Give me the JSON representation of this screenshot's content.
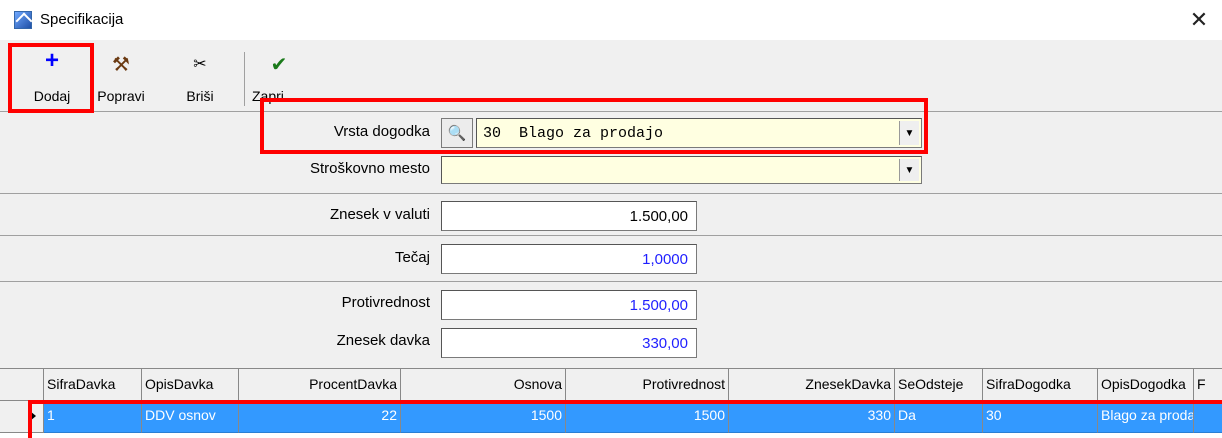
{
  "window": {
    "title": "Specifikacija",
    "close_glyph": "✕"
  },
  "toolbar": {
    "buttons": [
      {
        "label": "Dodaj",
        "icon": "plus-icon",
        "icon_glyph": "+",
        "color": "#0000ff"
      },
      {
        "label": "Popravi",
        "icon": "hammer-icon",
        "icon_glyph": "⚒",
        "color": "#6b3a12"
      },
      {
        "label": "Briši",
        "icon": "scissors-icon",
        "icon_glyph": "✂",
        "color": "#000000"
      },
      {
        "label": "Zapri",
        "icon": "checkmark-icon",
        "icon_glyph": "✔",
        "color": "#1a7a1a"
      }
    ]
  },
  "form": {
    "vrsta_dogodka": {
      "label": "Vrsta dogodka",
      "value": "30  Blago za prodajo"
    },
    "stroskovno_mesto": {
      "label": "Stroškovno mesto",
      "value": ""
    },
    "znesek_v_valuti": {
      "label": "Znesek v valuti",
      "value": "1.500,00"
    },
    "tecaj": {
      "label": "Tečaj",
      "value": "1,0000"
    },
    "protivrednost": {
      "label": "Protivrednost",
      "value": "1.500,00"
    },
    "znesek_davka": {
      "label": "Znesek davka",
      "value": "330,00"
    }
  },
  "grid": {
    "columns": [
      "SifraDavka",
      "OpisDavka",
      "ProcentDavka",
      "Osnova",
      "Protivrednost",
      "ZnesekDavka",
      "SeOdsteje",
      "SifraDogodka",
      "OpisDogodka",
      "F"
    ],
    "rows": [
      {
        "SifraDavka": "1",
        "OpisDavka": "DDV osnov",
        "ProcentDavka": "22",
        "Osnova": "1500",
        "Protivrednost": "1500",
        "ZnesekDavka": "330",
        "SeOdsteje": "Da",
        "SifraDogodka": "30",
        "OpisDogodka": "Blago za proda"
      }
    ]
  },
  "colors": {
    "highlight": "#ff0000",
    "selected_row": "#3399ff",
    "input_yellow": "#ffffe1",
    "value_blue": "#1f1fff"
  }
}
